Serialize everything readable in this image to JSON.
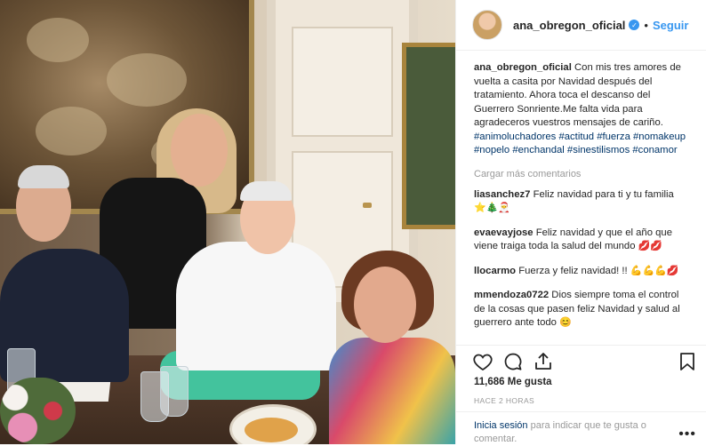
{
  "header": {
    "username": "ana_obregon_oficial",
    "separator": "•",
    "follow_label": "Seguir"
  },
  "caption": {
    "username": "ana_obregon_oficial",
    "text": "Con mis tres amores de vuelta a casita por Navidad después del tratamiento. Ahora toca el descanso del Guerrero Sonriente.Me falta vida para agradeceros vuestros mensajes de cariño.",
    "hashtags": [
      "#animoluchadores",
      "#actitud",
      "#fuerza",
      "#nomakeup",
      "#nopelo",
      "#enchandal",
      "#sinestilismos",
      "#conamor"
    ]
  },
  "load_more_label": "Cargar más comentarios",
  "comments": [
    {
      "username": "liasanchez7",
      "text": "Feliz navidad para ti y tu familia",
      "emoji": "⭐🎄🎅"
    },
    {
      "username": "evaevayjose",
      "text": "Feliz navidad y que el año que viene traiga toda la salud del mundo",
      "emoji": "💋💋"
    },
    {
      "username": "llocarmo",
      "text": "Fuerza y feliz navidad! !!",
      "emoji": "💪💪💪💋"
    },
    {
      "username": "mmendoza0722",
      "text": "Dios siempre toma el control de la cosas que pasen feliz Navidad y salud al guerrero ante todo",
      "emoji": "😊"
    }
  ],
  "likes": "11,686 Me gusta",
  "time_ago": "HACE 2 HORAS",
  "login": {
    "link_label": "Inicia sesión",
    "text": "para indicar que te gusta o comentar."
  },
  "more_label": "•••",
  "icons": {
    "like": "heart-icon",
    "comment": "comment-icon",
    "share": "share-icon",
    "save": "bookmark-icon",
    "verified": "verified-badge-icon"
  },
  "colors": {
    "link_blue": "#3897f0",
    "hashtag": "#003569",
    "muted": "#999999",
    "text": "#262626"
  }
}
